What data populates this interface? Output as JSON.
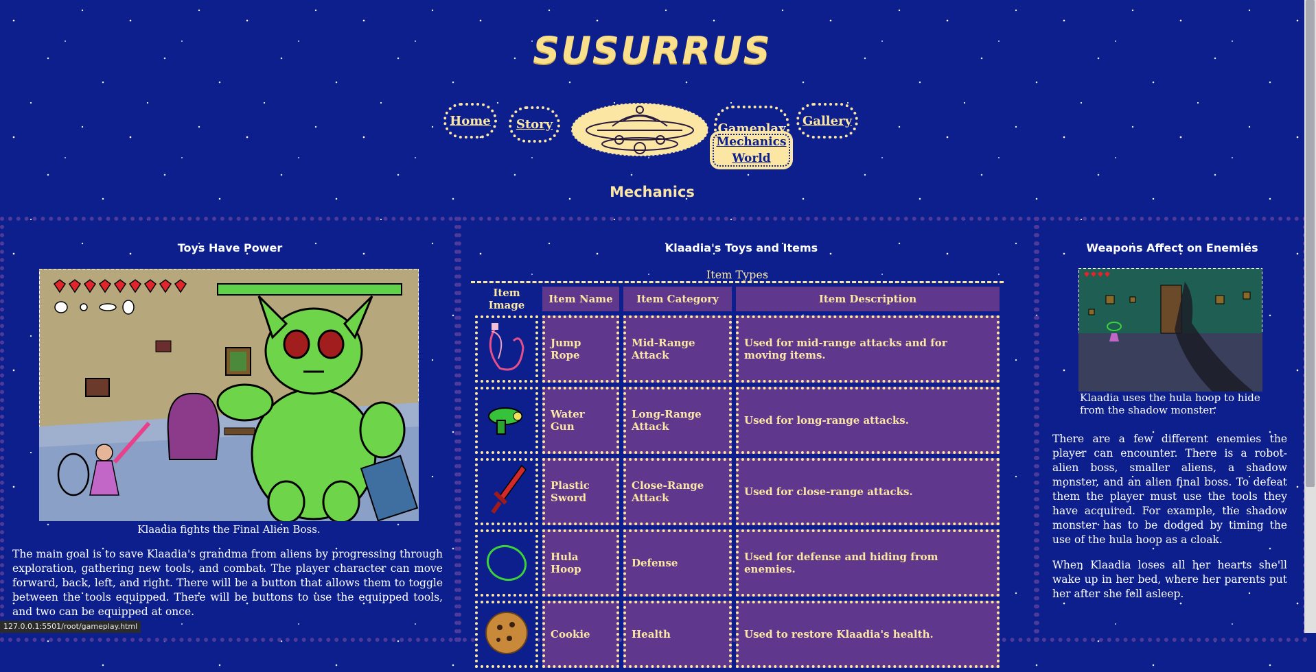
{
  "site": {
    "title": "SUSURRUS"
  },
  "nav": {
    "home": "Home",
    "story": "Story",
    "gameplay": "Gameplay",
    "gallery": "Gallery",
    "dropdown": {
      "mechanics": "Mechanics",
      "world": "World"
    }
  },
  "page": {
    "heading": "Mechanics"
  },
  "left": {
    "heading": "Toys Have Power",
    "caption": "Klaadia fights the Final Alien Boss.",
    "paragraph": "The main goal is to save Klaadia's grandma from aliens by progressing through exploration, gathering new tools, and combat. The player character can move forward, back, left, and right. There will be a button that allows them to toggle between the tools equipped. There will be buttons to use the equipped tools, and two can be equipped at once."
  },
  "center": {
    "heading": "Klaadia's Toys and Items",
    "table_caption": "Item Types",
    "columns": [
      "Item Image",
      "Item Name",
      "Item Category",
      "Item Description"
    ],
    "rows": [
      {
        "icon": "jump-rope",
        "name": "Jump Rope",
        "category": "Mid-Range Attack",
        "description": "Used for mid-range attacks and for moving items."
      },
      {
        "icon": "water-gun",
        "name": "Water Gun",
        "category": "Long-Range Attack",
        "description": "Used for long-range attacks."
      },
      {
        "icon": "plastic-sword",
        "name": "Plastic Sword",
        "category": "Close-Range Attack",
        "description": "Used for close-range attacks."
      },
      {
        "icon": "hula-hoop",
        "name": "Hula Hoop",
        "category": "Defense",
        "description": "Used for defense and hiding from enemies."
      },
      {
        "icon": "cookie",
        "name": "Cookie",
        "category": "Health",
        "description": "Used to restore Klaadia's health."
      }
    ]
  },
  "right": {
    "heading": "Weapons Affect on Enemies",
    "caption": "Klaadia uses the hula hoop to hide from the shadow monster.",
    "paragraph1": "There are a few different enemies the player can encounter. There is a robot-alien boss, smaller aliens, a shadow monster, and an alien final boss. To defeat them the player must use the tools they have acquired. For example, the shadow monster has to be dodged by timing the use of the hula hoop as a cloak.",
    "paragraph2": "When Klaadia loses all her hearts she'll wake up in her bed, where her parents put her after she fell asleep."
  },
  "status": {
    "url": "127.0.0.1:5501/root/gameplay.html"
  },
  "colors": {
    "background": "#0d1f8c",
    "accent": "#fbe7a3",
    "purple": "#5f378c",
    "dot_border": "#4d3a9a"
  }
}
